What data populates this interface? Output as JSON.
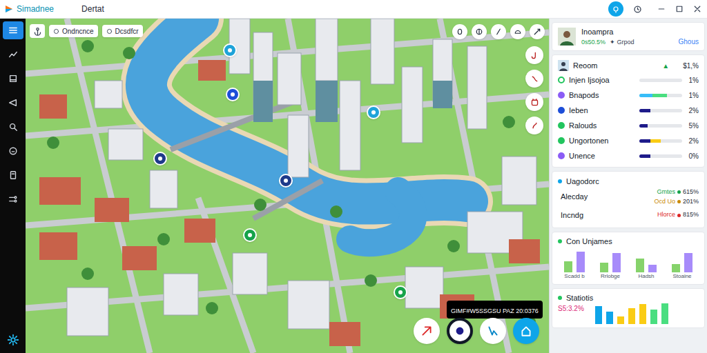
{
  "window": {
    "title": "Simadnee",
    "subtitle": "Dertat"
  },
  "sidebar": {
    "items": [
      {
        "selected": true
      },
      {
        "selected": false
      },
      {
        "selected": false
      },
      {
        "selected": false
      },
      {
        "selected": false
      },
      {
        "selected": false
      },
      {
        "selected": false
      },
      {
        "selected": false
      }
    ]
  },
  "map": {
    "chips": [
      "Ondncnce",
      "Dcsdfcr"
    ],
    "tooltip": "GIMF#W5SSGSU PAZ 20:0376"
  },
  "profile": {
    "name": "Inoampra",
    "stat": "0s50.5%",
    "tag": "✦ Grpod",
    "link": "Ghous"
  },
  "overview": {
    "label": "Reoom",
    "trend": "▲",
    "value": "$1,%",
    "rows": [
      {
        "name": "Injen Ijsojoa",
        "value": "1%",
        "color": "#22c55e",
        "segments": []
      },
      {
        "name": "Bnapods",
        "value": "1%",
        "color": "#8b5cf6",
        "segments": [
          {
            "level": 0.3,
            "color": "#38bdf8"
          },
          {
            "level": 0.35,
            "color": "#4ade80"
          }
        ]
      },
      {
        "name": "Ieben",
        "value": "2%",
        "color": "#1d4ed8",
        "segments": [
          {
            "level": 0.25,
            "color": "#1e1b8a"
          }
        ]
      },
      {
        "name": "Ralouds",
        "value": "5%",
        "color": "#22c55e",
        "segments": [
          {
            "level": 0.2,
            "color": "#1e1b8a"
          }
        ]
      },
      {
        "name": "Ungortonen",
        "value": "2%",
        "color": "#22c55e",
        "segments": [
          {
            "level": 0.25,
            "color": "#1e1b8a"
          },
          {
            "level": 0.25,
            "color": "#facc15"
          }
        ]
      },
      {
        "name": "Unence",
        "value": "0%",
        "color": "#8b5cf6",
        "segments": [
          {
            "level": 0.25,
            "color": "#1e1b8a"
          }
        ]
      }
    ]
  },
  "usage": {
    "title": "Uagodorc",
    "rows": [
      {
        "label": "Alecday",
        "entries": [
          {
            "name": "Gmtes",
            "value": "615%",
            "color": "#16a34a"
          },
          {
            "name": "Ocd Uo",
            "value": "201%",
            "color": "#ca8a04"
          }
        ]
      },
      {
        "label": "Incndg",
        "entries": [
          {
            "name": "Hlorce",
            "value": "815%",
            "color": "#dc2626"
          }
        ]
      }
    ]
  },
  "chart": {
    "title": "Con Unjames",
    "labels": [
      "Scadd b",
      "Rrlobge",
      "Hadsh",
      "Stoaine"
    ],
    "series": [
      {
        "values": [
          1.6,
          1.4,
          2.0,
          1.2
        ],
        "color": "#86d36b"
      },
      {
        "values": [
          3.0,
          2.8,
          1.1,
          2.8
        ],
        "color": "#a78bfa"
      }
    ]
  },
  "stations": {
    "title": "Statiotis",
    "value": "S5:3.2%",
    "bars": [
      {
        "value": 3.0,
        "color": "#0ea5e9"
      },
      {
        "value": 2.0,
        "color": "#0ea5e9"
      },
      {
        "value": 1.2,
        "color": "#facc15"
      },
      {
        "value": 2.6,
        "color": "#facc15"
      },
      {
        "value": 3.3,
        "color": "#facc15"
      },
      {
        "value": 2.4,
        "color": "#4ade80"
      },
      {
        "value": 3.4,
        "color": "#4ade80"
      }
    ]
  }
}
